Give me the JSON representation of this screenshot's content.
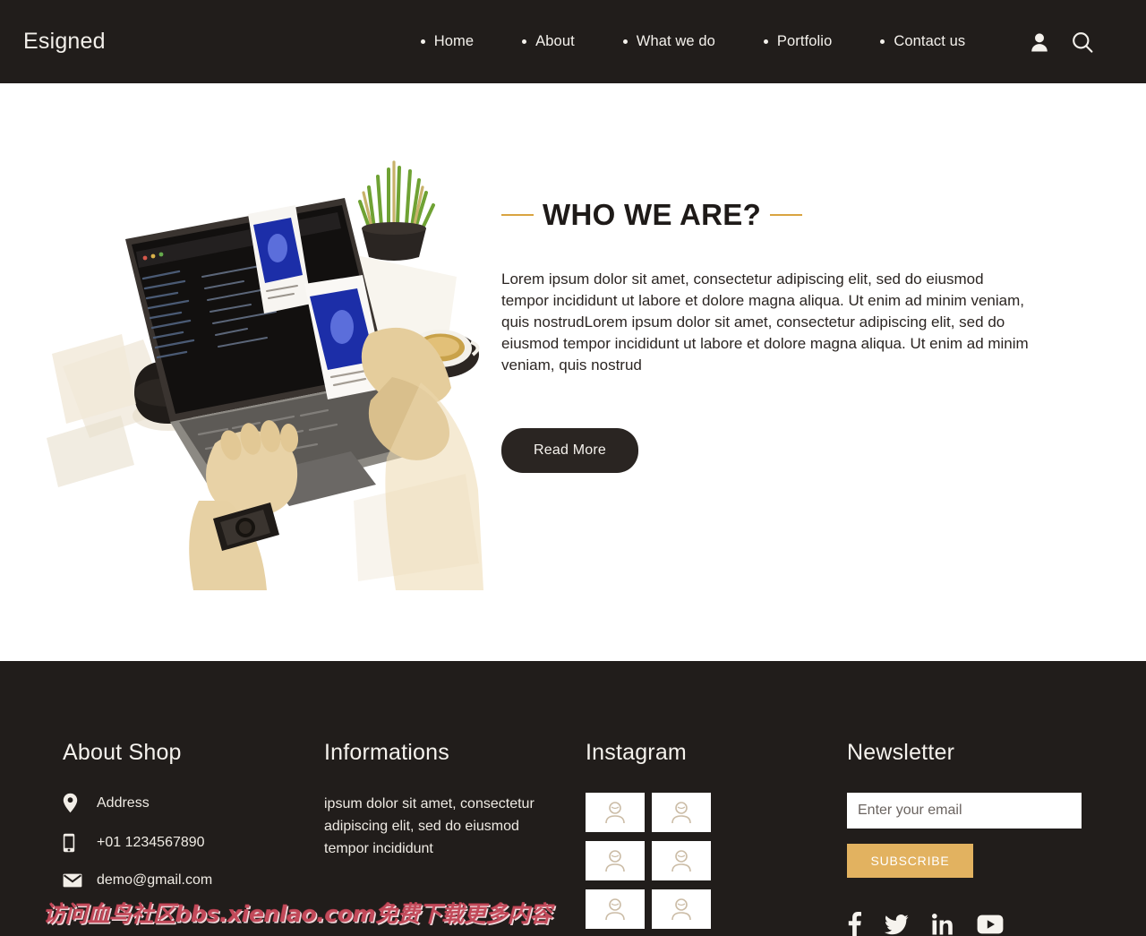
{
  "header": {
    "brand": "Esigned",
    "nav": [
      {
        "label": "Home"
      },
      {
        "label": "About"
      },
      {
        "label": "What we do"
      },
      {
        "label": "Portfolio"
      },
      {
        "label": "Contact us"
      }
    ],
    "account_icon": "user-icon",
    "search_icon": "search-icon"
  },
  "hero": {
    "title": "WHO WE ARE?",
    "paragraph": "Lorem ipsum dolor sit amet, consectetur adipiscing elit, sed do eiusmod tempor incididunt ut labore et dolore magna aliqua. Ut enim ad minim veniam, quis nostrudLorem ipsum dolor sit amet, consectetur adipiscing elit, sed do eiusmod tempor incididunt ut labore et dolore magna aliqua. Ut enim ad minim veniam, quis nostrud",
    "cta_label": "Read More",
    "image_alt": "laptop-workspace-photo"
  },
  "footer": {
    "about": {
      "heading": "About Shop",
      "rows": [
        {
          "icon": "location-pin-icon",
          "text": "Address"
        },
        {
          "icon": "phone-icon",
          "text": "+01 1234567890"
        },
        {
          "icon": "envelope-icon",
          "text": "demo@gmail.com"
        }
      ]
    },
    "informations": {
      "heading": "Informations",
      "text": "ipsum dolor sit amet, consectetur adipiscing elit, sed do eiusmod tempor incididunt"
    },
    "instagram": {
      "heading": "Instagram",
      "thumbs": [
        {
          "alt": "instagram-thumb-1"
        },
        {
          "alt": "instagram-thumb-2"
        },
        {
          "alt": "instagram-thumb-3"
        },
        {
          "alt": "instagram-thumb-4"
        },
        {
          "alt": "instagram-thumb-5"
        },
        {
          "alt": "instagram-thumb-6"
        }
      ]
    },
    "newsletter": {
      "heading": "Newsletter",
      "email_value": "",
      "email_placeholder": "Enter your email",
      "subscribe_label": "SUBSCRIBE",
      "social": [
        {
          "name": "facebook-icon"
        },
        {
          "name": "twitter-icon"
        },
        {
          "name": "linkedin-icon"
        },
        {
          "name": "youtube-icon"
        }
      ]
    }
  },
  "watermark": {
    "text": "访问血鸟社区bbs.xienlao.com免费下载更多内容"
  },
  "colors": {
    "dark": "#211D1B",
    "gold": "#E2B260",
    "rule_gold": "#D9A441",
    "text_light": "#F2EFEA",
    "watermark_red": "#C24A5A"
  }
}
